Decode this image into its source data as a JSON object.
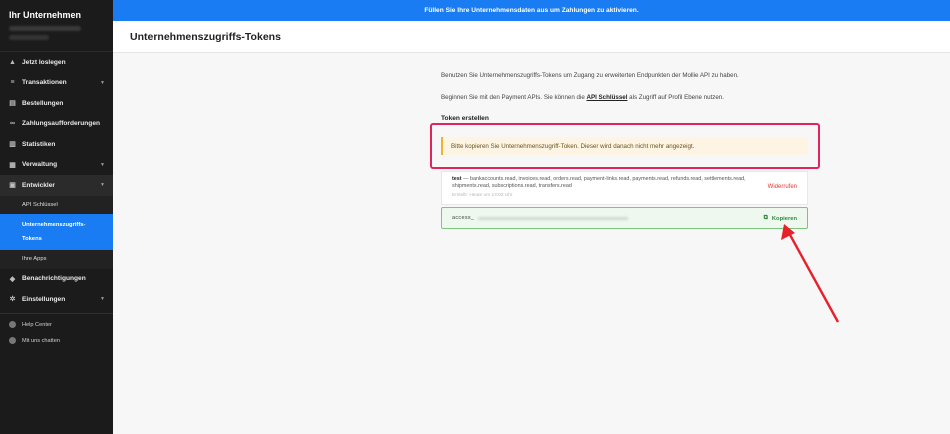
{
  "sidebar": {
    "company": "Ihr Unternehmen",
    "items": [
      {
        "label": "Jetzt loslegen",
        "icon": "rocket-icon"
      },
      {
        "label": "Transaktionen",
        "icon": "list-icon",
        "chevron": true
      },
      {
        "label": "Bestellungen",
        "icon": "orders-icon"
      },
      {
        "label": "Zahlungsaufforderungen",
        "icon": "link-icon"
      },
      {
        "label": "Statistiken",
        "icon": "chart-icon"
      },
      {
        "label": "Verwaltung",
        "icon": "admin-icon",
        "chevron": true
      },
      {
        "label": "Entwickler",
        "icon": "code-icon",
        "chevron": true
      }
    ],
    "developer_sub": [
      {
        "label": "API Schlüssel"
      },
      {
        "label_line1": "Unternehmenszugriffs-",
        "label_line2": "Tokens"
      },
      {
        "label": "Ihre Apps"
      }
    ],
    "items_after": [
      {
        "label": "Benachrichtigungen",
        "icon": "bell-icon"
      },
      {
        "label": "Einstellungen",
        "icon": "gear-icon",
        "chevron": true
      }
    ],
    "footer": [
      {
        "label": "Help Center",
        "icon": "help-icon"
      },
      {
        "label": "Mit uns chatten",
        "icon": "chat-icon"
      }
    ]
  },
  "banner": {
    "text": "Füllen Sie Ihre Unternehmensdaten aus um Zahlungen zu aktivieren."
  },
  "header": {
    "title": "Unternehmenszugriffs-Tokens"
  },
  "content": {
    "intro": "Benutzen Sie Unternehmenszugriffs-Tokens um Zugang zu erweiterten Endpunkten der Mollie API zu haben.",
    "p2_before": "Beginnen Sie mit den Payment APIs. Sie können die ",
    "p2_link": "API Schlüssel",
    "p2_after": " als Zugriff auf Profil Ebene nutzen.",
    "section_title": "Token erstellen",
    "alert": "Bitte kopieren Sie Unternehmenszugriff-Token. Dieser wird danach nicht mehr angezeigt.",
    "token": {
      "name": "test",
      "scopes": " — bankaccounts.read, invoices.read, orders.read, payment-links.read, payments.read, refunds.read, settlements.read, shipments.read, subscriptions.read, transfers.read",
      "created": "Erstellt: Heute um 13:02 Uhr",
      "revoke_label": "Widerrufen",
      "value_prefix": "access_",
      "copy_label": "Kopieren"
    }
  },
  "colors": {
    "accent": "#1a7cf3",
    "highlight": "#e0245e",
    "success": "#2e8b3e",
    "danger": "#e53935"
  }
}
